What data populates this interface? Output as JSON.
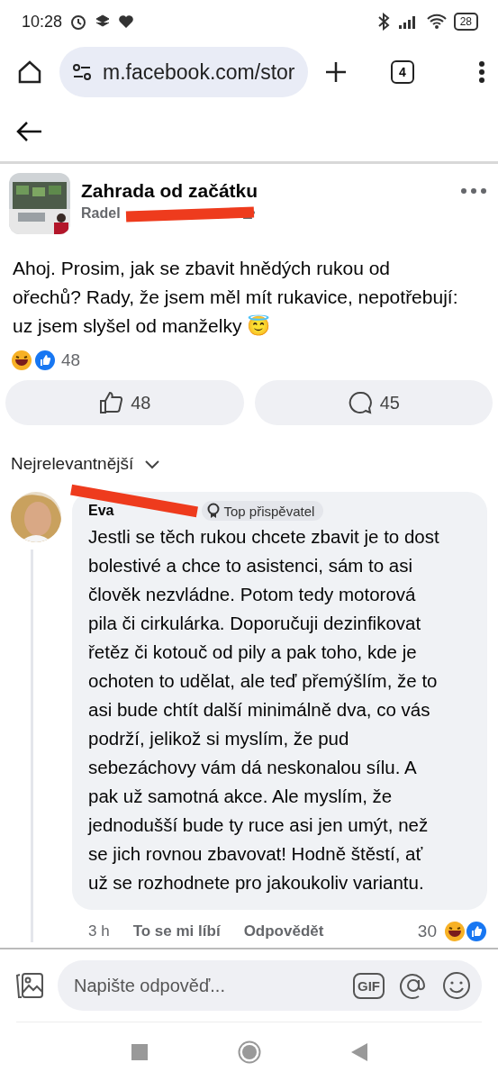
{
  "status_bar": {
    "time": "10:28",
    "battery": "28"
  },
  "browser": {
    "url": "m.facebook.com/stor",
    "tab_count": "4"
  },
  "post": {
    "group": "Zahrada od začátku",
    "author": "Radel",
    "text": "Ahoj. Prosim, jak se zbavit hnědých rukou od ořechů? Rady, že jsem měl mít rukavice, nepotřebují: uz jsem slyšel od manželky 😇",
    "reaction_count": "48",
    "like_count": "48",
    "comment_count": "45"
  },
  "sort": {
    "label": "Nejrelevantnější"
  },
  "comment": {
    "author": "Eva",
    "badge": "Top přispěvatel",
    "text": "Jestli se těch rukou chcete zbavit je to dost bolestivé a chce to asistenci, sám to asi člověk nezvládne. Potom tedy motorová pila či cirkulárka. Doporučuji dezinfikovat řetěz či kotouč od pily a pak toho, kde je ochoten to udělat, ale teď přemýšlím, že to asi bude chtít další minimálně dva, co vás podrží, jelikož si myslím, že pud sebezáchovy vám dá neskonalou sílu.  A pak už samotná akce. Ale myslím, že jednodušší bude ty ruce asi jen umýt, než se jich rovnou zbavovat! Hodně štěstí, ať už se rozhodnete pro jakoukoliv variantu.",
    "time": "3 h",
    "like_action": "To se mi líbí",
    "reply_action": "Odpovědět",
    "reaction_count": "30"
  },
  "composer": {
    "placeholder": "Napište odpověď...",
    "gif_label": "GIF"
  }
}
